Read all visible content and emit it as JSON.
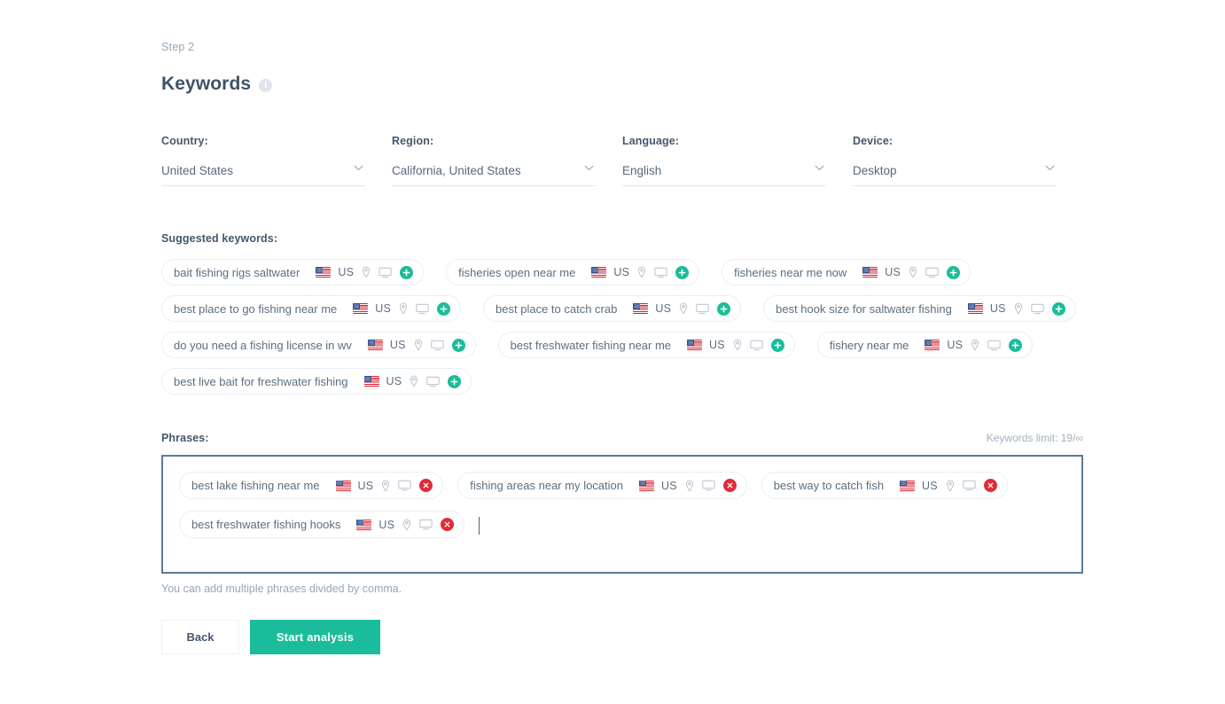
{
  "header": {
    "step": "Step 2",
    "title": "Keywords",
    "info_icon": "info-icon",
    "info_glyph": "i"
  },
  "filters": [
    {
      "label": "Country:",
      "value": "United States",
      "name": "country"
    },
    {
      "label": "Region:",
      "value": "California, United States",
      "name": "region"
    },
    {
      "label": "Language:",
      "value": "English",
      "name": "language"
    },
    {
      "label": "Device:",
      "value": "Desktop",
      "name": "device"
    }
  ],
  "suggested": {
    "label": "Suggested keywords:",
    "country_code": "US",
    "items": [
      {
        "text": "bait fishing rigs saltwater",
        "country": "US"
      },
      {
        "text": "fisheries open near me",
        "country": "US"
      },
      {
        "text": "fisheries near me now",
        "country": "US"
      },
      {
        "text": "best place to go fishing near me",
        "country": "US"
      },
      {
        "text": "best place to catch crab",
        "country": "US"
      },
      {
        "text": "best hook size for saltwater fishing",
        "country": "US"
      },
      {
        "text": "do you need a fishing license in wv",
        "country": "US"
      },
      {
        "text": "best freshwater fishing near me",
        "country": "US"
      },
      {
        "text": "fishery near me",
        "country": "US"
      },
      {
        "text": "best live bait for freshwater fishing",
        "country": "US"
      }
    ]
  },
  "phrases": {
    "label": "Phrases:",
    "limit_text": "Keywords limit: 19/∞",
    "hint": "You can add multiple phrases divided by comma.",
    "items": [
      {
        "text": "best lake fishing near me",
        "country": "US"
      },
      {
        "text": "fishing areas near my location",
        "country": "US"
      },
      {
        "text": "best way to catch fish",
        "country": "US"
      },
      {
        "text": "best freshwater fishing hooks",
        "country": "US"
      }
    ]
  },
  "actions": {
    "back": "Back",
    "start": "Start analysis"
  },
  "colors": {
    "accent_teal": "#1bbc9b",
    "delete_red": "#e02b38",
    "focus_border": "#5c7b9e",
    "text": "#44586d",
    "muted": "#9aa7b8"
  }
}
